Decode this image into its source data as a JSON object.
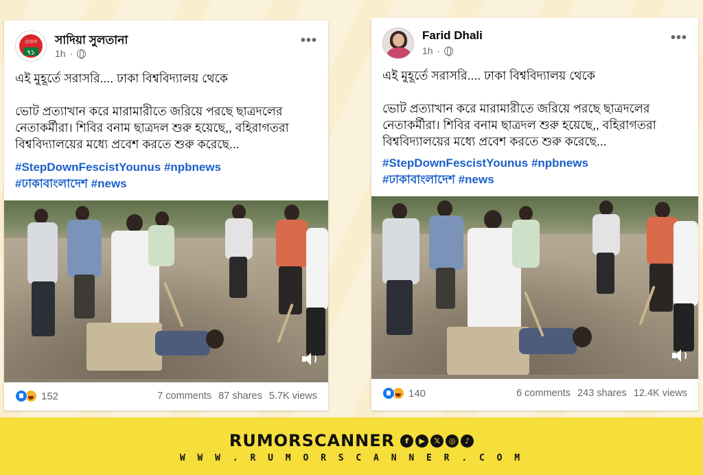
{
  "posts": [
    {
      "author": "সাদিয়া সুলতানা",
      "avatar_text_top": "চেতনা",
      "avatar_text_bottom": "৭১",
      "time": "1h",
      "line1": "এই মুহূর্তে সরাসরি.... ঢাকা বিশ্ববিদ্যালয় থেকে",
      "line2": "ভোট প্রত্যাখান করে মারামারীতে জরিয়ে পরছে ছাত্রদলের নেতাকর্মীরা। শিবির বনাম ছাত্রদল শুরু হয়েছে,, বহিরাগতরা বিশ্ববিদ্যালয়ের মধ্যে প্রবেশ করতে শুরু করেছে...",
      "hashtags_1": "#StepDownFescistYounus #npbnews",
      "hashtags_2": "#ঢাকাবাংলাদেশ #news",
      "reactions": "152",
      "comments": "7 comments",
      "shares": "87 shares",
      "views": "5.7K views"
    },
    {
      "author": "Farid Dhali",
      "time": "1h",
      "line1": "এই মুহূর্তে সরাসরি.... ঢাকা বিশ্ববিদ্যালয় থেকে",
      "line2": "ভোট প্রত্যাখান করে মারামারীতে জরিয়ে পরছে ছাত্রদলের নেতাকর্মীরা। শিবির বনাম ছাত্রদল শুরু হয়েছে,, বহিরাগতরা বিশ্ববিদ্যালয়ের মধ্যে প্রবেশ করতে শুরু করেছে...",
      "hashtags_1": "#StepDownFescistYounus #npbnews",
      "hashtags_2": "#ঢাকাবাংলাদেশ #news",
      "reactions": "140",
      "comments": "6 comments",
      "shares": "243 shares",
      "views": "12.4K views"
    }
  ],
  "footer": {
    "brand": "RUMORSCANNER",
    "url": "W W W . R U M O R S C A N N E R . C O M",
    "social_icons": [
      "facebook-icon",
      "youtube-icon",
      "x-icon",
      "instagram-icon",
      "tiktok-icon"
    ],
    "social_glyphs": [
      "f",
      "▶",
      "𝕏",
      "◎",
      "♪"
    ]
  },
  "colors": {
    "hashtag": "#1b5fc9",
    "banner": "#f6de3b",
    "meta_gray": "#65676b"
  }
}
